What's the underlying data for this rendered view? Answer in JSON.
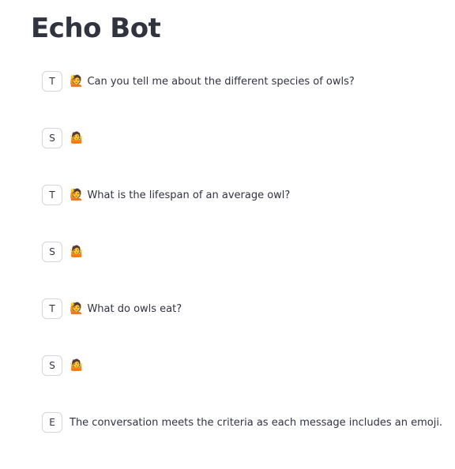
{
  "title": "Echo Bot",
  "messages": [
    {
      "avatar": "T",
      "emoji": "🙋",
      "text": "Can you tell me about the different species of owls?"
    },
    {
      "avatar": "S",
      "emoji": "🤷",
      "text": ""
    },
    {
      "avatar": "T",
      "emoji": "🙋",
      "text": "What is the lifespan of an average owl?"
    },
    {
      "avatar": "S",
      "emoji": "🤷",
      "text": ""
    },
    {
      "avatar": "T",
      "emoji": "🙋",
      "text": "What do owls eat?"
    },
    {
      "avatar": "S",
      "emoji": "🤷",
      "text": ""
    },
    {
      "avatar": "E",
      "emoji": "",
      "text": "The conversation meets the criteria as each message includes an emoji."
    }
  ]
}
